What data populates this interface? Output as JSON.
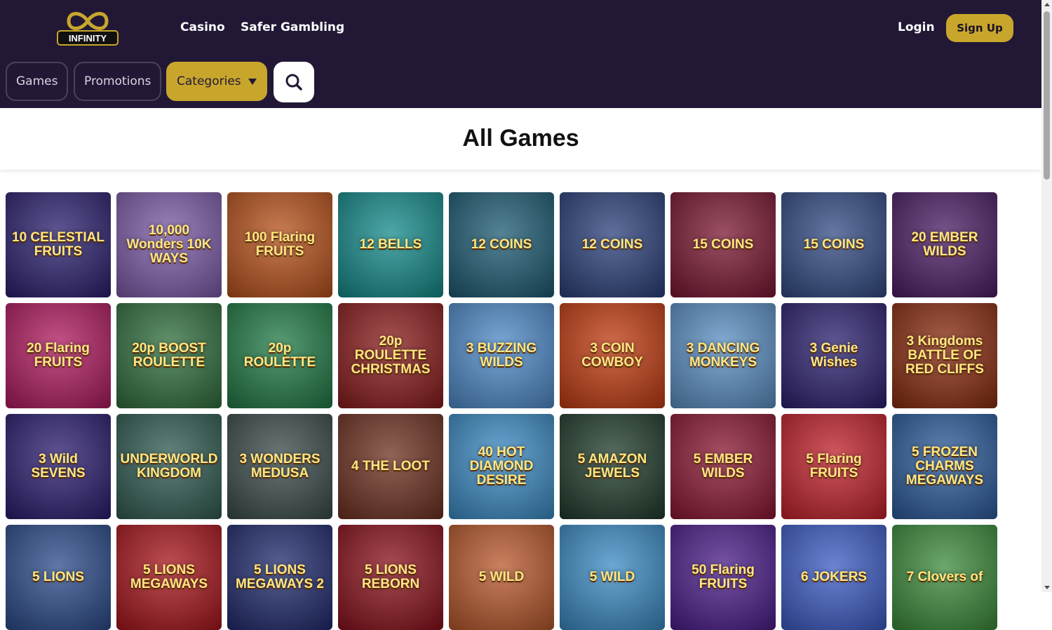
{
  "brand": {
    "logo_text": "INFINITY"
  },
  "nav": {
    "casino": "Casino",
    "safer_gambling": "Safer Gambling"
  },
  "auth": {
    "login": "Login",
    "signup": "Sign Up"
  },
  "filters": {
    "games": "Games",
    "promotions": "Promotions",
    "categories": "Categories"
  },
  "page": {
    "title": "All Games"
  },
  "colors": {
    "header_bg": "#221836",
    "accent_gold": "#c8a62c"
  },
  "games": [
    {
      "name": "10 CELESTIAL FRUITS",
      "bg": "#2a1f6e"
    },
    {
      "name": "10,000 Wonders 10K WAYS",
      "bg": "#7b5aa8"
    },
    {
      "name": "100 Flaring FRUITS",
      "bg": "#b8511a"
    },
    {
      "name": "12 BELLS",
      "bg": "#138a8a"
    },
    {
      "name": "12 COINS",
      "bg": "#1b5a72"
    },
    {
      "name": "12 COINS",
      "bg": "#2a3f7a"
    },
    {
      "name": "15 COINS",
      "bg": "#7a1530"
    },
    {
      "name": "15 COINS",
      "bg": "#314a84"
    },
    {
      "name": "20 EMBER WILDS",
      "bg": "#4a1b63"
    },
    {
      "name": "20 Flaring FRUITS",
      "bg": "#b0195e"
    },
    {
      "name": "20p BOOST ROULETTE",
      "bg": "#2f6e3c"
    },
    {
      "name": "20p ROULETTE",
      "bg": "#1f7a45"
    },
    {
      "name": "20p ROULETTE CHRISTMAS",
      "bg": "#8a1a1a"
    },
    {
      "name": "3 BUZZING WILDS",
      "bg": "#4d8ac9"
    },
    {
      "name": "3 COIN COWBOY",
      "bg": "#c23a0f"
    },
    {
      "name": "3 DANCING MONKEYS",
      "bg": "#5a8fc4"
    },
    {
      "name": "3 Genie Wishes",
      "bg": "#2a1f6e"
    },
    {
      "name": "3 Kingdoms BATTLE OF RED CLIFFS",
      "bg": "#8a2a0f"
    },
    {
      "name": "3 Wild SEVENS",
      "bg": "#2a1b6e"
    },
    {
      "name": "UNDERWORLD KINGDOM",
      "bg": "#2f5a52"
    },
    {
      "name": "3 WONDERS MEDUSA",
      "bg": "#3a4a4a"
    },
    {
      "name": "4 THE LOOT",
      "bg": "#6e2f1f"
    },
    {
      "name": "40 HOT DIAMOND DESIRE",
      "bg": "#3a8ac4"
    },
    {
      "name": "5 AMAZON JEWELS",
      "bg": "#1f3a2a"
    },
    {
      "name": "5 EMBER WILDS",
      "bg": "#8a1530"
    },
    {
      "name": "5 Flaring FRUITS",
      "bg": "#c21f2a"
    },
    {
      "name": "5 FROZEN CHARMS MEGAWAYS",
      "bg": "#2a5a9a"
    },
    {
      "name": "5 LIONS",
      "bg": "#2a4a8a"
    },
    {
      "name": "5 LIONS MEGAWAYS",
      "bg": "#a8141a"
    },
    {
      "name": "5 LIONS MEGAWAYS 2",
      "bg": "#1f2a6e"
    },
    {
      "name": "5 LIONS REBORN",
      "bg": "#8a0f1a"
    },
    {
      "name": "5 WILD",
      "bg": "#b8572a"
    },
    {
      "name": "5 WILD",
      "bg": "#3a8ac4"
    },
    {
      "name": "50 Flaring FRUITS",
      "bg": "#4a1b8a"
    },
    {
      "name": "6 JOKERS",
      "bg": "#3a5ac4"
    },
    {
      "name": "7 Clovers of",
      "bg": "#3a8a3a"
    }
  ]
}
